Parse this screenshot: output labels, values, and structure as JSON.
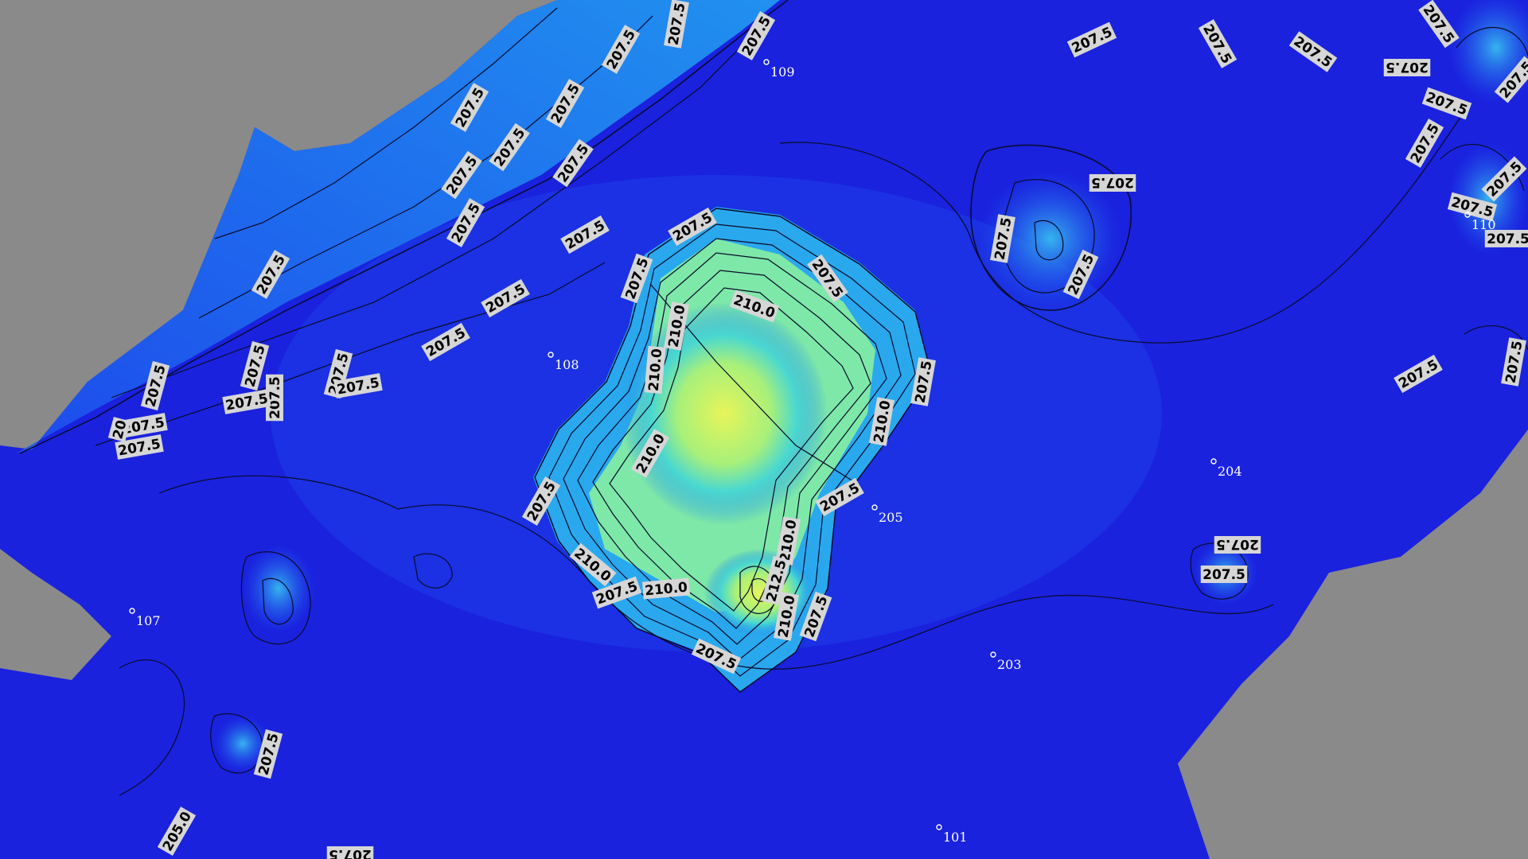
{
  "map": {
    "colors": {
      "no_data": "#8a8a8a",
      "low": "#1a16d8",
      "mid": "#1f6bf0",
      "high": "#d8f25a"
    },
    "contour_labels": [
      "207.5",
      "207.5",
      "207.5",
      "207.5",
      "207.5",
      "207.5",
      "207.5",
      "207.5",
      "207.5",
      "207.5",
      "207.5",
      "207.5",
      "207.5",
      "207.5",
      "207.5",
      "207.5",
      "207.5",
      "207.5",
      "207.5",
      "207.5",
      "207.5",
      "207.5",
      "207.5",
      "207.5",
      "207.5",
      "207.5",
      "207.5",
      "207.5",
      "207.5",
      "207.5",
      "207.5",
      "207.5",
      "207.5",
      "207.5",
      "207.5",
      "207.5",
      "207.5",
      "207.5",
      "207.5",
      "207.5",
      "207.5",
      "207.5",
      "207.5",
      "207.5",
      "207.5",
      "207.5",
      "207.5",
      "207.5",
      "207.5",
      "207.5",
      "210.0",
      "210.0",
      "210.0",
      "210.0",
      "210.0",
      "210.0",
      "210.0",
      "210.0",
      "210.0",
      "212.5",
      "205.0",
      "20"
    ],
    "stations": [
      "109",
      "108",
      "107",
      "205",
      "204",
      "203",
      "110",
      "101"
    ]
  }
}
